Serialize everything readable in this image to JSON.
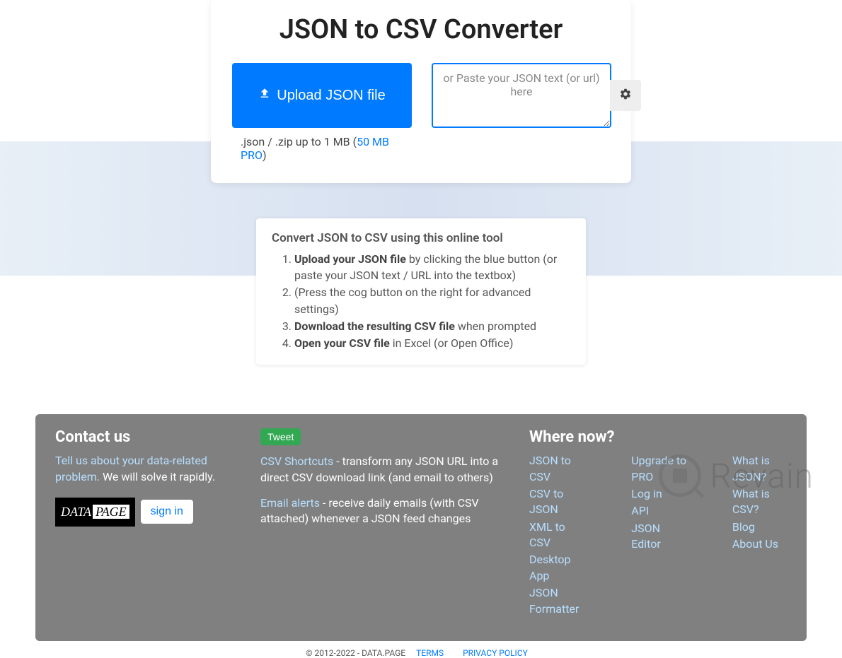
{
  "main": {
    "title": "JSON to CSV Converter",
    "upload_label": "Upload JSON file",
    "upload_note_prefix": ".json / .zip up to 1 MB (",
    "upload_note_link": "50 MB PRO",
    "upload_note_suffix": ")",
    "paste_placeholder": "or Paste your JSON text (or url) here"
  },
  "instructions": {
    "heading": "Convert JSON to CSV using this online tool",
    "steps": [
      {
        "bold": "Upload your JSON file",
        "rest": " by clicking the blue button (or paste your JSON text / URL into the textbox)"
      },
      {
        "bold": "",
        "rest": "(Press the cog button on the right for advanced settings)"
      },
      {
        "bold": "Download the resulting CSV file",
        "rest": " when prompted"
      },
      {
        "bold": "Open your CSV file",
        "rest": " in Excel (or Open Office)"
      }
    ]
  },
  "footer": {
    "contact": {
      "heading": "Contact us",
      "link_text": "Tell us about your data-related problem.",
      "tail": " We will solve it rapidly.",
      "signin": "sign in"
    },
    "middle": {
      "tweet": "Tweet",
      "shortcuts_link": "CSV Shortcuts",
      "shortcuts_text": " - transform any JSON URL into a direct CSV download link (and email to others)",
      "alerts_link": "Email alerts",
      "alerts_text": " - receive daily emails (with CSV attached) whenever a JSON feed changes"
    },
    "wherenow": {
      "heading": "Where now?",
      "col1": [
        "JSON to CSV",
        "CSV to JSON",
        "XML to CSV",
        "Desktop App",
        "JSON Formatter"
      ],
      "col2": [
        "Upgrade to PRO",
        "Log in",
        "API",
        "JSON Editor"
      ],
      "col3": [
        "What is JSON?",
        "What is CSV?",
        "Blog",
        "About Us"
      ]
    }
  },
  "copyright": {
    "text": "© 2012-2022 - DATA.PAGE",
    "terms": "TERMS",
    "privacy": "PRIVACY POLICY"
  },
  "watermark": "Revain"
}
